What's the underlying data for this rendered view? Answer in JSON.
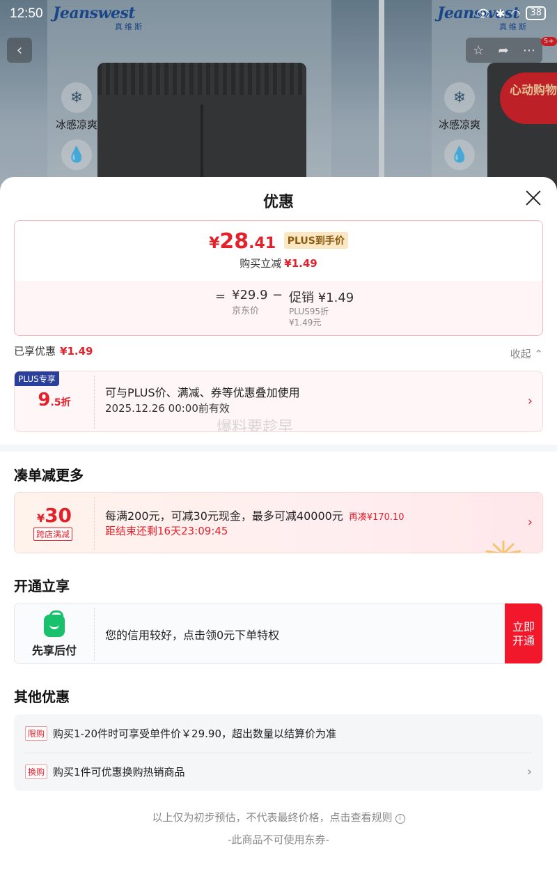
{
  "status_bar": {
    "time": "12:50",
    "battery": "38"
  },
  "background": {
    "brand": "Jeanswest",
    "brand_sub": "真维斯",
    "feature_1": "冰感凉爽",
    "notification_count": "5+",
    "promo_banner": "心动购物季"
  },
  "sheet": {
    "title": "优惠"
  },
  "price_card": {
    "currency": "¥",
    "price_int": "28",
    "price_dec": ".41",
    "plus_tag": "PLUS到手价",
    "reduce_label": "购买立减",
    "reduce_value": "¥1.49",
    "eq": "=",
    "base_value": "¥29.9",
    "base_label": "京东价",
    "minus": "−",
    "promo_value": "促销 ¥1.49",
    "promo_sub1": "PLUS95折",
    "promo_sub2": "¥1.49元"
  },
  "enjoyed": {
    "label": "已享优惠",
    "value": "¥1.49",
    "collapse": "收起"
  },
  "plus_card": {
    "label": "PLUS专享",
    "discount_main": "9",
    "discount_sub": ".5折",
    "text": "可与PLUS价、满减、券等优惠叠加使用",
    "validity": "2025.12.26 00:00前有效",
    "watermark": "爆料要趁早"
  },
  "section_more": {
    "title": "凑单减更多"
  },
  "coupon": {
    "currency": "¥",
    "amount": "30",
    "tag": "跨店满减",
    "main": "每满200元，可减30元现金，最多可减40000元",
    "hint": "再凑¥170.10",
    "timer": "距结束还剩16天23:09:45"
  },
  "section_open": {
    "title": "开通立享"
  },
  "credit": {
    "name": "先享后付",
    "text": "您的信用较好，点击领0元下单特权",
    "button_line1": "立即",
    "button_line2": "开通"
  },
  "section_other": {
    "title": "其他优惠"
  },
  "other_rows": [
    {
      "badge": "限购",
      "text": "购买1-20件时可享受单件价￥29.90，超出数量以结算价为准"
    },
    {
      "badge": "换购",
      "text": "购买1件可优惠换购热销商品"
    }
  ],
  "footer": {
    "note": "以上仅为初步预估，不代表最终价格，点击查看规则",
    "info_icon": "i",
    "coupon_note": "-此商品不可使用东券-"
  }
}
